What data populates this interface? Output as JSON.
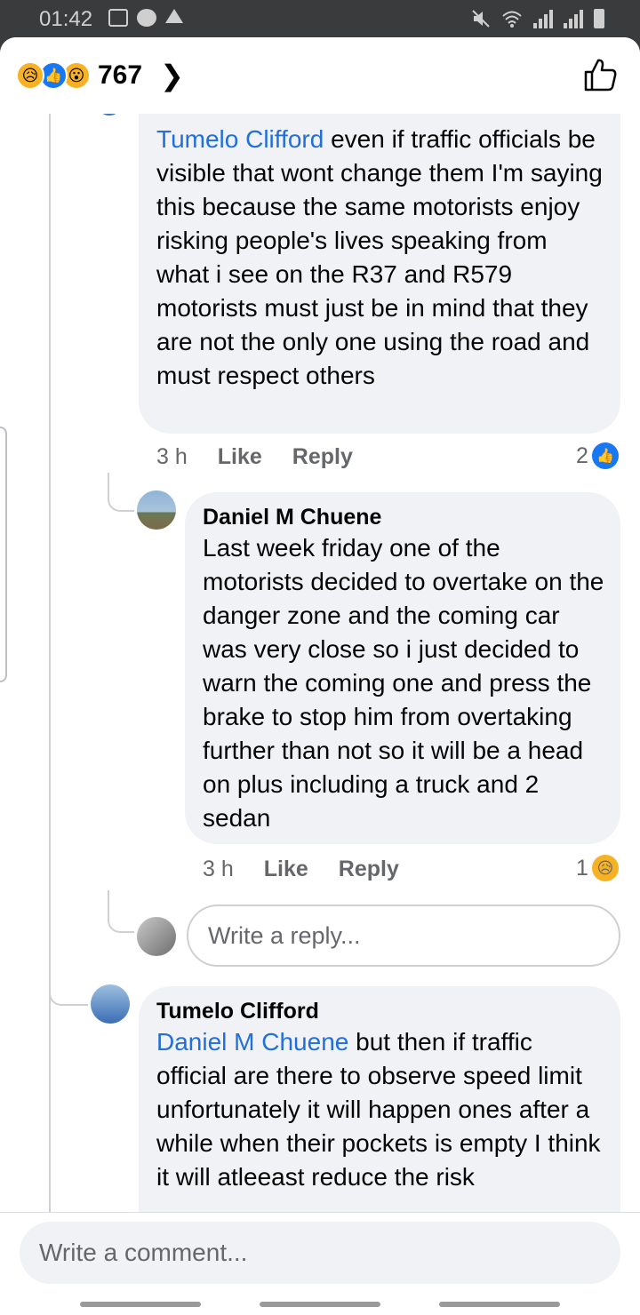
{
  "status_bar": {
    "time": "01:42"
  },
  "header": {
    "reaction_count": "767"
  },
  "comments": [
    {
      "mention": "Tumelo Clifford",
      "text": " even if traffic officials be visible that wont change them I'm saying this because the same motorists enjoy risking people's lives speaking from what i see on the R37 and R579 motorists must just be in mind that they are not the only one using the road and must respect others",
      "time": "3 h",
      "like": "Like",
      "reply": "Reply",
      "reaction_count": "2"
    },
    {
      "author": "Daniel M Chuene",
      "text": "Last week friday one of the motorists decided to overtake on the danger zone and the coming car was very close so i just decided to warn the coming one and press the brake to stop him from overtaking  further than not so it will be a head on plus including a truck and 2 sedan",
      "time": "3 h",
      "like": "Like",
      "reply": "Reply",
      "reaction_count": "1"
    },
    {
      "author": "Tumelo Clifford",
      "mention": "Daniel M Chuene",
      "text": " but then if traffic official are there to observe speed limit unfortunately it will happen ones after a while when their pockets is empty I think it will atleeast reduce the risk"
    }
  ],
  "reply_input": {
    "placeholder": "Write a reply..."
  },
  "comment_input": {
    "placeholder": "Write a comment..."
  }
}
